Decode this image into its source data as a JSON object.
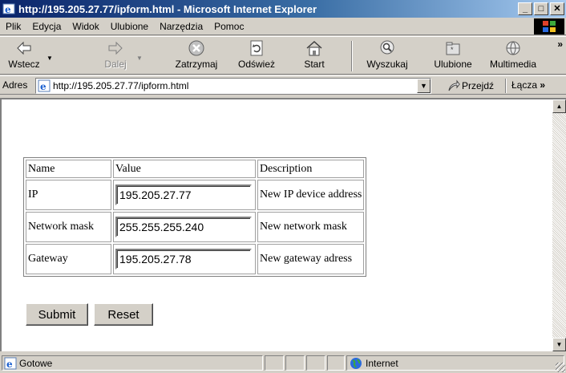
{
  "window": {
    "title": "http://195.205.27.77/ipform.html - Microsoft Internet Explorer",
    "minimize_glyph": "_",
    "maximize_glyph": "□",
    "close_glyph": "✕"
  },
  "menu": {
    "items": [
      {
        "label": "Plik",
        "accel": "P"
      },
      {
        "label": "Edycja",
        "accel": "E"
      },
      {
        "label": "Widok",
        "accel": "W"
      },
      {
        "label": "Ulubione",
        "accel": "U"
      },
      {
        "label": "Narzędzia",
        "accel": "N"
      },
      {
        "label": "Pomoc",
        "accel": "c"
      }
    ]
  },
  "toolbar": {
    "back": "Wstecz",
    "forward": "Dalej",
    "stop": "Zatrzymaj",
    "refresh": "Odśwież",
    "home": "Start",
    "search": "Wyszukaj",
    "favorites": "Ulubione",
    "media": "Multimedia",
    "more": "»"
  },
  "address": {
    "label": "Adres",
    "url": "http://195.205.27.77/ipform.html",
    "go": "Przejdź",
    "links": "Łącza",
    "links_more": "»"
  },
  "form": {
    "headers": [
      "Name",
      "Value",
      "Description"
    ],
    "rows": [
      {
        "name": "IP",
        "value": "195.205.27.77",
        "description": "New IP device address"
      },
      {
        "name": "Network mask",
        "value": "255.255.255.240",
        "description": "New network mask"
      },
      {
        "name": "Gateway",
        "value": "195.205.27.78",
        "description": "New gateway adress"
      }
    ],
    "submit": "Submit",
    "reset": "Reset"
  },
  "status": {
    "text": "Gotowe",
    "zone": "Internet"
  },
  "colors": {
    "titlebar_start": "#0a246a",
    "titlebar_end": "#a6caf0",
    "chrome": "#d4d0c8"
  }
}
